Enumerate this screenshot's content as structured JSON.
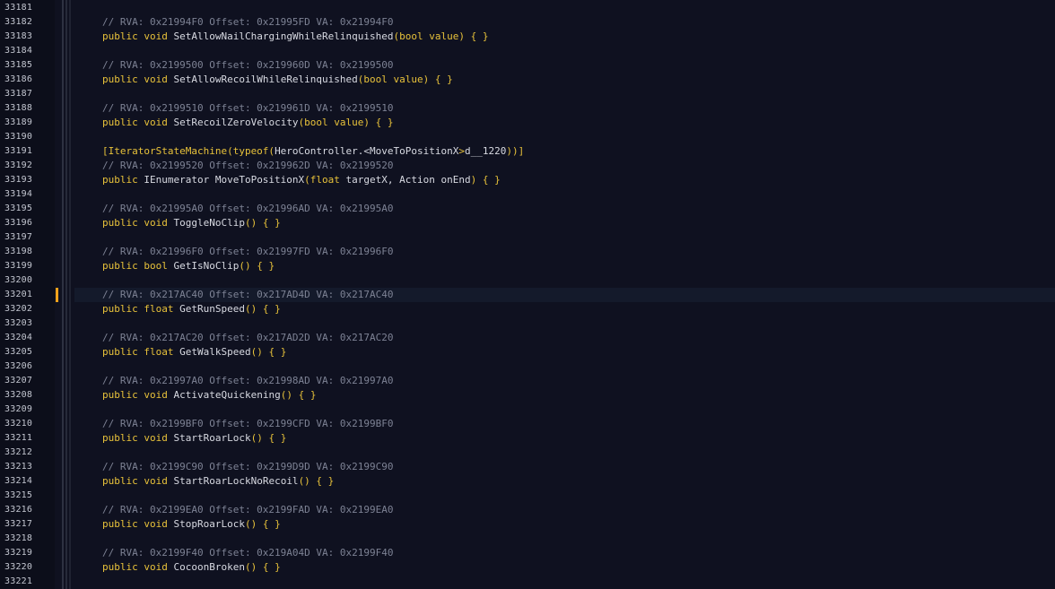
{
  "colors": {
    "background": "#0f1120",
    "gutter": "#0c0e1a",
    "line_number": "#c3c6d0",
    "comment": "#7d8294",
    "keyword": "#e8c23a",
    "identifier": "#d8dae2",
    "modified_marker": "#f5a21a",
    "current_line": "#141a2b"
  },
  "editor": {
    "current_line": "33201",
    "modified_line": "33201",
    "lines": [
      {
        "num": "33181",
        "tokens": []
      },
      {
        "num": "33182",
        "tokens": [
          {
            "t": "comment",
            "v": "// RVA: 0x21994F0 Offset: 0x21995FD VA: 0x21994F0"
          }
        ]
      },
      {
        "num": "33183",
        "tokens": [
          {
            "t": "kw",
            "v": "public void "
          },
          {
            "t": "id",
            "v": "SetAllowNailChargingWhileRelinquished"
          },
          {
            "t": "kw",
            "v": "(bool value) { }"
          }
        ]
      },
      {
        "num": "33184",
        "tokens": []
      },
      {
        "num": "33185",
        "tokens": [
          {
            "t": "comment",
            "v": "// RVA: 0x2199500 Offset: 0x219960D VA: 0x2199500"
          }
        ]
      },
      {
        "num": "33186",
        "tokens": [
          {
            "t": "kw",
            "v": "public void "
          },
          {
            "t": "id",
            "v": "SetAllowRecoilWhileRelinquished"
          },
          {
            "t": "kw",
            "v": "(bool value) { }"
          }
        ]
      },
      {
        "num": "33187",
        "tokens": []
      },
      {
        "num": "33188",
        "tokens": [
          {
            "t": "comment",
            "v": "// RVA: 0x2199510 Offset: 0x219961D VA: 0x2199510"
          }
        ]
      },
      {
        "num": "33189",
        "tokens": [
          {
            "t": "kw",
            "v": "public void "
          },
          {
            "t": "id",
            "v": "SetRecoilZeroVelocity"
          },
          {
            "t": "kw",
            "v": "(bool value) { }"
          }
        ]
      },
      {
        "num": "33190",
        "tokens": []
      },
      {
        "num": "33191",
        "tokens": [
          {
            "t": "kw",
            "v": "[IteratorStateMachine(typeof("
          },
          {
            "t": "id",
            "v": "HeroController.<MoveToPositionX"
          },
          {
            "t": "kw",
            "v": ">"
          },
          {
            "t": "id",
            "v": "d__1220"
          },
          {
            "t": "kw",
            "v": "))]"
          }
        ]
      },
      {
        "num": "33192",
        "tokens": [
          {
            "t": "comment",
            "v": "// RVA: 0x2199520 Offset: 0x219962D VA: 0x2199520"
          }
        ]
      },
      {
        "num": "33193",
        "tokens": [
          {
            "t": "kw",
            "v": "public "
          },
          {
            "t": "id",
            "v": "IEnumerator MoveToPositionX"
          },
          {
            "t": "kw",
            "v": "(float "
          },
          {
            "t": "id",
            "v": "targetX, Action onEnd"
          },
          {
            "t": "kw",
            "v": ") { }"
          }
        ]
      },
      {
        "num": "33194",
        "tokens": []
      },
      {
        "num": "33195",
        "tokens": [
          {
            "t": "comment",
            "v": "// RVA: 0x21995A0 Offset: 0x21996AD VA: 0x21995A0"
          }
        ]
      },
      {
        "num": "33196",
        "tokens": [
          {
            "t": "kw",
            "v": "public void "
          },
          {
            "t": "id",
            "v": "ToggleNoClip"
          },
          {
            "t": "kw",
            "v": "() { }"
          }
        ]
      },
      {
        "num": "33197",
        "tokens": []
      },
      {
        "num": "33198",
        "tokens": [
          {
            "t": "comment",
            "v": "// RVA: 0x21996F0 Offset: 0x21997FD VA: 0x21996F0"
          }
        ]
      },
      {
        "num": "33199",
        "tokens": [
          {
            "t": "kw",
            "v": "public bool "
          },
          {
            "t": "id",
            "v": "GetIsNoClip"
          },
          {
            "t": "kw",
            "v": "() { }"
          }
        ]
      },
      {
        "num": "33200",
        "tokens": []
      },
      {
        "num": "33201",
        "tokens": [
          {
            "t": "comment",
            "v": "// RVA: 0x217AC40 Offset: 0x217AD4D VA: 0x217AC40"
          }
        ]
      },
      {
        "num": "33202",
        "tokens": [
          {
            "t": "kw",
            "v": "public float "
          },
          {
            "t": "id",
            "v": "GetRunSpeed"
          },
          {
            "t": "kw",
            "v": "() { }"
          }
        ]
      },
      {
        "num": "33203",
        "tokens": []
      },
      {
        "num": "33204",
        "tokens": [
          {
            "t": "comment",
            "v": "// RVA: 0x217AC20 Offset: 0x217AD2D VA: 0x217AC20"
          }
        ]
      },
      {
        "num": "33205",
        "tokens": [
          {
            "t": "kw",
            "v": "public float "
          },
          {
            "t": "id",
            "v": "GetWalkSpeed"
          },
          {
            "t": "kw",
            "v": "() { }"
          }
        ]
      },
      {
        "num": "33206",
        "tokens": []
      },
      {
        "num": "33207",
        "tokens": [
          {
            "t": "comment",
            "v": "// RVA: 0x21997A0 Offset: 0x21998AD VA: 0x21997A0"
          }
        ]
      },
      {
        "num": "33208",
        "tokens": [
          {
            "t": "kw",
            "v": "public void "
          },
          {
            "t": "id",
            "v": "ActivateQuickening"
          },
          {
            "t": "kw",
            "v": "() { }"
          }
        ]
      },
      {
        "num": "33209",
        "tokens": []
      },
      {
        "num": "33210",
        "tokens": [
          {
            "t": "comment",
            "v": "// RVA: 0x2199BF0 Offset: 0x2199CFD VA: 0x2199BF0"
          }
        ]
      },
      {
        "num": "33211",
        "tokens": [
          {
            "t": "kw",
            "v": "public void "
          },
          {
            "t": "id",
            "v": "StartRoarLock"
          },
          {
            "t": "kw",
            "v": "() { }"
          }
        ]
      },
      {
        "num": "33212",
        "tokens": []
      },
      {
        "num": "33213",
        "tokens": [
          {
            "t": "comment",
            "v": "// RVA: 0x2199C90 Offset: 0x2199D9D VA: 0x2199C90"
          }
        ]
      },
      {
        "num": "33214",
        "tokens": [
          {
            "t": "kw",
            "v": "public void "
          },
          {
            "t": "id",
            "v": "StartRoarLockNoRecoil"
          },
          {
            "t": "kw",
            "v": "() { }"
          }
        ]
      },
      {
        "num": "33215",
        "tokens": []
      },
      {
        "num": "33216",
        "tokens": [
          {
            "t": "comment",
            "v": "// RVA: 0x2199EA0 Offset: 0x2199FAD VA: 0x2199EA0"
          }
        ]
      },
      {
        "num": "33217",
        "tokens": [
          {
            "t": "kw",
            "v": "public void "
          },
          {
            "t": "id",
            "v": "StopRoarLock"
          },
          {
            "t": "kw",
            "v": "() { }"
          }
        ]
      },
      {
        "num": "33218",
        "tokens": []
      },
      {
        "num": "33219",
        "tokens": [
          {
            "t": "comment",
            "v": "// RVA: 0x2199F40 Offset: 0x219A04D VA: 0x2199F40"
          }
        ]
      },
      {
        "num": "33220",
        "tokens": [
          {
            "t": "kw",
            "v": "public void "
          },
          {
            "t": "id",
            "v": "CocoonBroken"
          },
          {
            "t": "kw",
            "v": "() { }"
          }
        ]
      },
      {
        "num": "33221",
        "tokens": []
      }
    ]
  }
}
